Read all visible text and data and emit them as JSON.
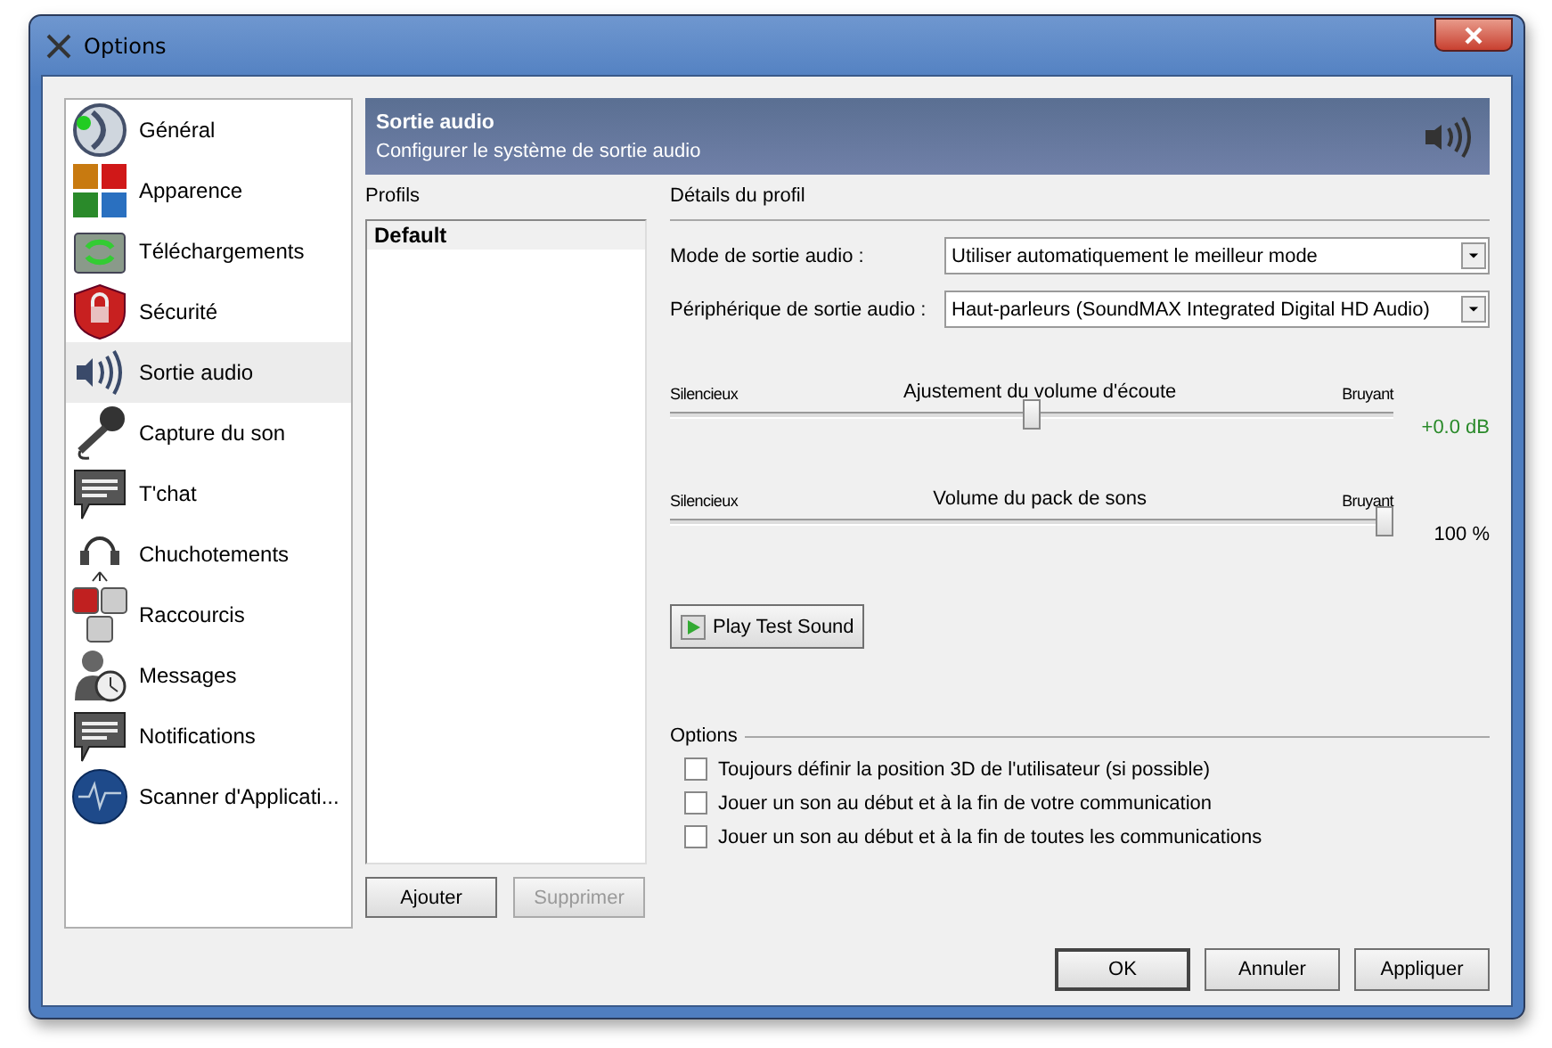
{
  "window": {
    "title": "Options"
  },
  "sidebar": {
    "items": [
      {
        "label": "Général",
        "selected": false
      },
      {
        "label": "Apparence",
        "selected": false
      },
      {
        "label": "Téléchargements",
        "selected": false
      },
      {
        "label": "Sécurité",
        "selected": false
      },
      {
        "label": "Sortie audio",
        "selected": true
      },
      {
        "label": "Capture du son",
        "selected": false
      },
      {
        "label": "T'chat",
        "selected": false
      },
      {
        "label": "Chuchotements",
        "selected": false
      },
      {
        "label": "Raccourcis",
        "selected": false
      },
      {
        "label": "Messages",
        "selected": false
      },
      {
        "label": "Notifications",
        "selected": false
      },
      {
        "label": "Scanner d'Applicati..."
      }
    ]
  },
  "header": {
    "title": "Sortie audio",
    "subtitle": "Configurer le système de sortie audio"
  },
  "profiles": {
    "title": "Profils",
    "items": [
      {
        "label": "Default",
        "selected": true
      }
    ],
    "buttons": [
      {
        "label": "Ajouter",
        "disabled": false
      },
      {
        "label": "Supprimer",
        "disabled": true
      }
    ]
  },
  "details": {
    "title": "Détails du profil",
    "fields": [
      {
        "label": "Mode de sortie audio :",
        "value": "Utiliser automatiquement le meilleur mode"
      },
      {
        "label": "Périphérique de sortie audio :",
        "value": "Haut-parleurs (SoundMAX Integrated Digital HD Audio)"
      }
    ],
    "sliders": [
      {
        "min_label": "Silencieux",
        "title": "Ajustement du volume d'écoute",
        "max_label": "Bruyant",
        "level": 0.5,
        "reading": "+0.0 dB"
      },
      {
        "min_label": "Silencieux",
        "title": "Volume du pack de sons",
        "max_label": "Bruyant",
        "level": 1.0,
        "reading": "100 %"
      }
    ],
    "test_button": "Play Test Sound",
    "options": {
      "title": "Options",
      "items": [
        {
          "label": "Toujours définir la position 3D de l'utilisateur (si possible)",
          "checked": false
        },
        {
          "label": "Jouer un son au début et à la fin de votre communication",
          "checked": false
        },
        {
          "label": "Jouer un son au début et à la fin de toutes les communications",
          "checked": false
        }
      ]
    }
  },
  "buttons": [
    {
      "label": "OK",
      "default": true
    },
    {
      "label": "Annuler",
      "default": false
    },
    {
      "label": "Appliquer",
      "default": false
    }
  ]
}
